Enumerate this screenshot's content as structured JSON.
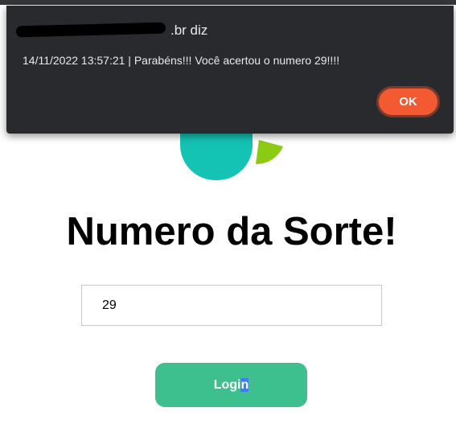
{
  "alert": {
    "title_suffix": ".br diz",
    "message": "14/11/2022 13:57:21 | Parabéns!!! Você acertou o numero 29!!!!",
    "ok_label": "OK"
  },
  "page": {
    "title": "Numero da Sorte!"
  },
  "form": {
    "number_value": "29",
    "login_label_main": "Logi",
    "login_label_selected": "n"
  },
  "colors": {
    "dialog_bg": "#292a2d",
    "ok_button": "#f35a32",
    "login_button": "#3dbf8e",
    "logo_teal": "#14c3b4",
    "logo_green": "#8ccb13"
  }
}
